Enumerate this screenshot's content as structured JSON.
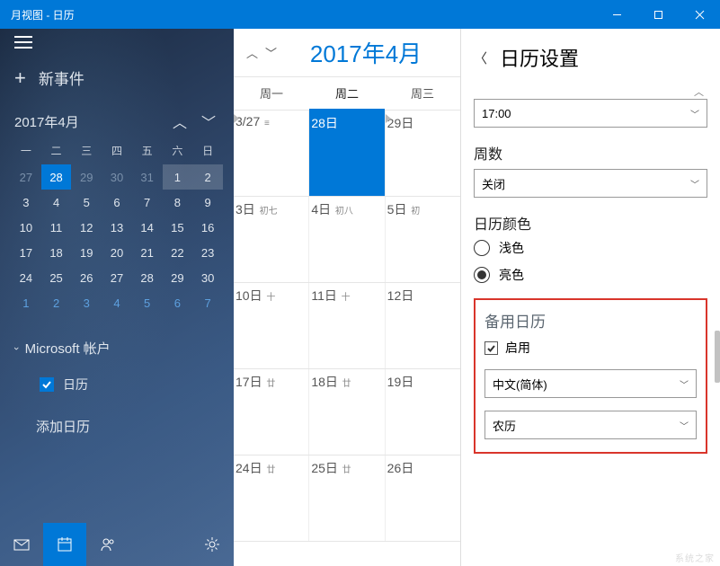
{
  "titlebar": {
    "text": "月视图 - 日历"
  },
  "sidebar": {
    "new_event": "新事件",
    "month_title": "2017年4月",
    "dow": [
      "一",
      "二",
      "三",
      "四",
      "五",
      "六",
      "日"
    ],
    "mini_cal": [
      [
        {
          "d": "27",
          "cls": "prev-month"
        },
        {
          "d": "28",
          "cls": "selected"
        },
        {
          "d": "29",
          "cls": "prev-month"
        },
        {
          "d": "30",
          "cls": "prev-month"
        },
        {
          "d": "31",
          "cls": "prev-month"
        },
        {
          "d": "1",
          "cls": "today"
        },
        {
          "d": "2",
          "cls": "today"
        }
      ],
      [
        {
          "d": "3",
          "cls": ""
        },
        {
          "d": "4",
          "cls": ""
        },
        {
          "d": "5",
          "cls": ""
        },
        {
          "d": "6",
          "cls": ""
        },
        {
          "d": "7",
          "cls": ""
        },
        {
          "d": "8",
          "cls": ""
        },
        {
          "d": "9",
          "cls": ""
        }
      ],
      [
        {
          "d": "10",
          "cls": ""
        },
        {
          "d": "11",
          "cls": ""
        },
        {
          "d": "12",
          "cls": ""
        },
        {
          "d": "13",
          "cls": ""
        },
        {
          "d": "14",
          "cls": ""
        },
        {
          "d": "15",
          "cls": ""
        },
        {
          "d": "16",
          "cls": ""
        }
      ],
      [
        {
          "d": "17",
          "cls": ""
        },
        {
          "d": "18",
          "cls": ""
        },
        {
          "d": "19",
          "cls": ""
        },
        {
          "d": "20",
          "cls": ""
        },
        {
          "d": "21",
          "cls": ""
        },
        {
          "d": "22",
          "cls": ""
        },
        {
          "d": "23",
          "cls": ""
        }
      ],
      [
        {
          "d": "24",
          "cls": ""
        },
        {
          "d": "25",
          "cls": ""
        },
        {
          "d": "26",
          "cls": ""
        },
        {
          "d": "27",
          "cls": ""
        },
        {
          "d": "28",
          "cls": ""
        },
        {
          "d": "29",
          "cls": ""
        },
        {
          "d": "30",
          "cls": ""
        }
      ]
    ],
    "mini_cal_next": [
      "1",
      "2",
      "3",
      "4",
      "5",
      "6",
      "7"
    ],
    "account": "Microsoft 帐户",
    "calendar_name": "日历",
    "add_calendar": "添加日历"
  },
  "main": {
    "title": "2017年4月",
    "dow": [
      "周一",
      "周二",
      "周三"
    ],
    "today_col": 1,
    "weeks": [
      [
        {
          "n": "3/27",
          "l": "≡",
          "tri": true
        },
        {
          "n": "28日",
          "l": "",
          "sel": true
        },
        {
          "n": "29日",
          "l": "",
          "tri": true
        }
      ],
      [
        {
          "n": "3日",
          "l": "初七"
        },
        {
          "n": "4日",
          "l": "初八"
        },
        {
          "n": "5日",
          "l": "初"
        }
      ],
      [
        {
          "n": "10日",
          "l": "十"
        },
        {
          "n": "11日",
          "l": "十"
        },
        {
          "n": "12日",
          "l": ""
        }
      ],
      [
        {
          "n": "17日",
          "l": "廿"
        },
        {
          "n": "18日",
          "l": "廿"
        },
        {
          "n": "19日",
          "l": ""
        }
      ],
      [
        {
          "n": "24日",
          "l": "廿"
        },
        {
          "n": "25日",
          "l": "廿"
        },
        {
          "n": "26日",
          "l": ""
        }
      ]
    ]
  },
  "settings": {
    "title": "日历设置",
    "time_value": "17:00",
    "weeks_label": "周数",
    "weeks_value": "关闭",
    "color_label": "日历颜色",
    "color_light": "浅色",
    "color_bright": "亮色",
    "color_selected": "bright",
    "alt_title": "备用日历",
    "enable_label": "启用",
    "lang_value": "中文(简体)",
    "cal_type_value": "农历"
  },
  "watermark": "系统之家"
}
